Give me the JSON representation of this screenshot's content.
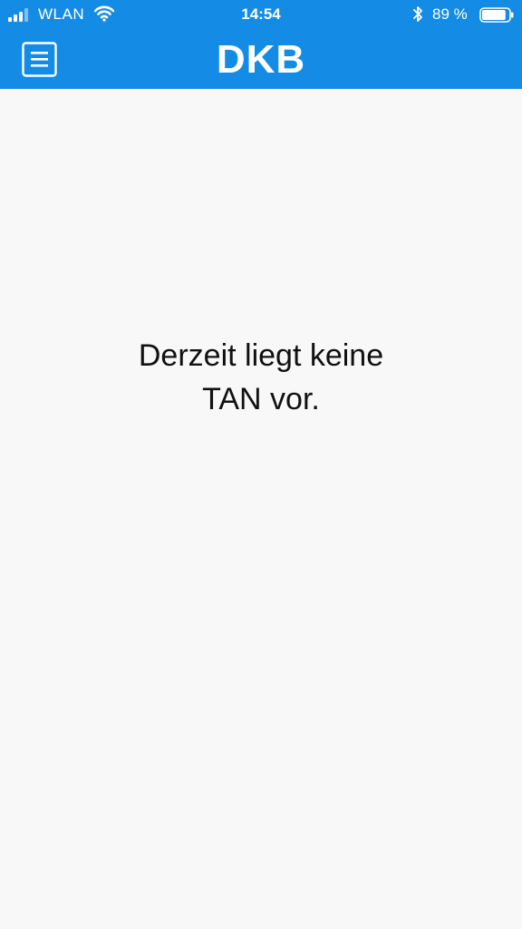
{
  "status_bar": {
    "carrier": "WLAN",
    "time": "14:54",
    "battery_percent": "89 %",
    "signal_icon": "signal-bars-icon",
    "wifi_icon": "wifi-icon",
    "bluetooth_icon": "bluetooth-icon",
    "battery_icon": "battery-icon",
    "battery_level": 0.89
  },
  "header": {
    "logo_text": "DKB",
    "menu_icon": "hamburger-menu-icon",
    "background_color": "#148ce6"
  },
  "main": {
    "message_line1": "Derzeit liegt keine",
    "message_line2": "TAN vor."
  }
}
